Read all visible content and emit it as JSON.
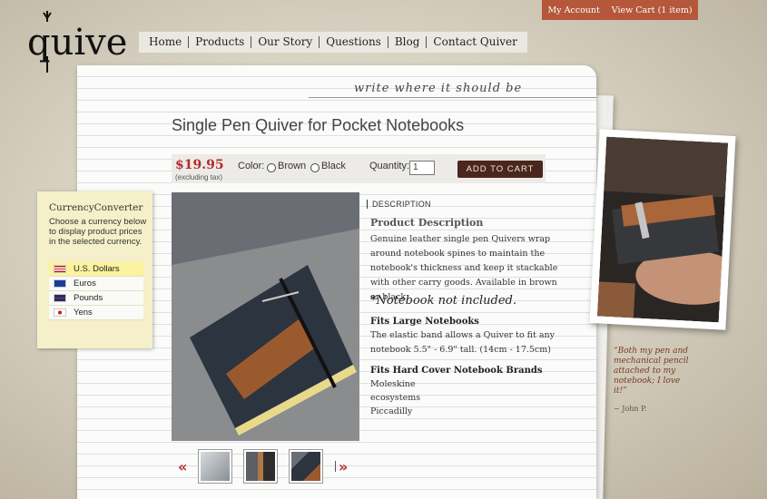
{
  "site": {
    "logo_text": "quiver",
    "tagline": "write where it should be"
  },
  "header": {
    "my_account": "My Account",
    "view_cart": "View Cart (1 item)"
  },
  "nav": [
    "Home",
    "Products",
    "Our Story",
    "Questions",
    "Blog",
    "Contact Quiver"
  ],
  "product": {
    "title": "Single Pen Quiver for Pocket Notebooks",
    "price": "$19.95",
    "price_note": "(excluding tax)",
    "color_label": "Color:",
    "color_options": [
      "Brown",
      "Black"
    ],
    "quantity_label": "Quantity:",
    "quantity_value": "1",
    "add_to_cart": "ADD TO CART",
    "description_tab": "DESCRIPTION",
    "description_heading": "Product Description",
    "description_text": "Genuine leather single pen Quivers wrap around notebook spines to maintain the notebook's thickness and keep it stackable with other carry goods.  Available in brown or black.",
    "not_included": "*Notebook not included.",
    "fits_large_heading": "Fits Large Notebooks",
    "fits_large_text": "The elastic band allows a Quiver to fit any notebook 5.5\" - 6.9\" tall. (14cm - 17.5cm)",
    "fits_hard_heading": "Fits Hard Cover Notebook Brands",
    "brands": [
      "Moleskine",
      "ecosystems",
      "Piccadilly"
    ]
  },
  "currency": {
    "title": "CurrencyConverter",
    "instructions": "Choose a currency below to display product prices in the selected currency.",
    "options": [
      "U.S. Dollars",
      "Euros",
      "Pounds",
      "Yens"
    ],
    "selected": "U.S. Dollars"
  },
  "testimonial": {
    "quote": "“Both my pen and mechanical pencil attached to my notebook; I love it!”",
    "author": "~ John P."
  },
  "icons": {
    "prev": "«",
    "next": "»"
  }
}
